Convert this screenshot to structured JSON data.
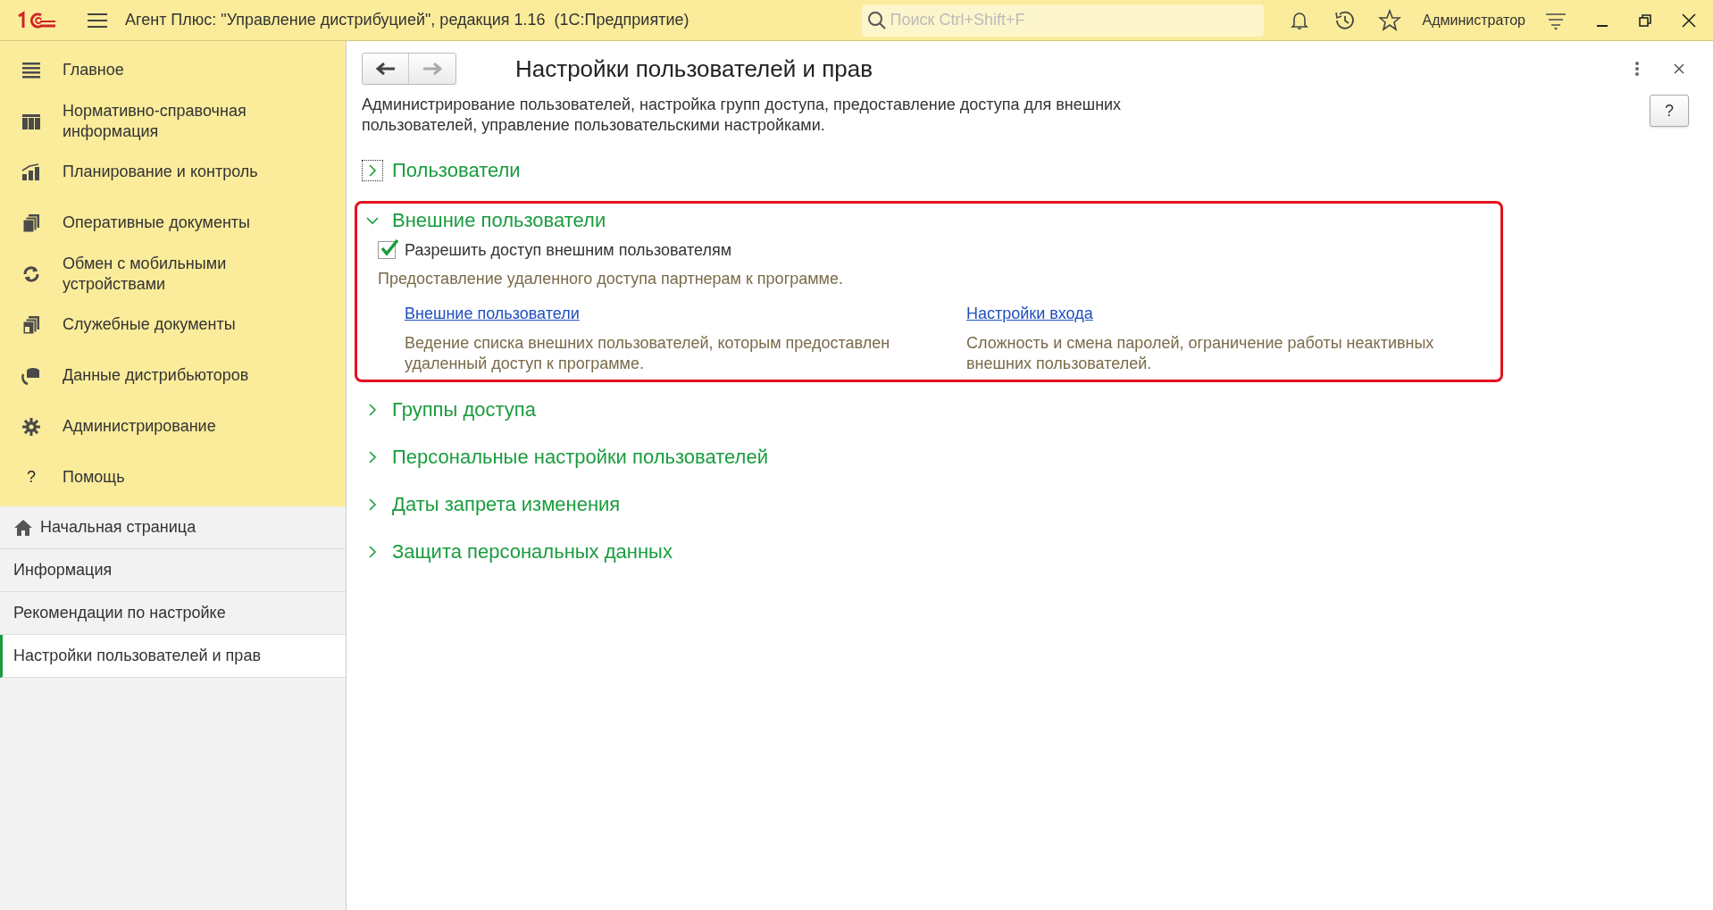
{
  "window": {
    "title": "Агент Плюс: \"Управление дистрибуцией\", редакция 1.16  (1С:Предприятие)",
    "search_placeholder": "Поиск Ctrl+Shift+F",
    "user": "Администратор"
  },
  "sections_menu": [
    {
      "label": "Главное"
    },
    {
      "label": "Нормативно-справочная информация"
    },
    {
      "label": "Планирование и контроль"
    },
    {
      "label": "Оперативные документы"
    },
    {
      "label": "Обмен с мобильными устройствами"
    },
    {
      "label": "Служебные документы"
    },
    {
      "label": "Данные дистрибьюторов"
    },
    {
      "label": "Администрирование"
    },
    {
      "label": "Помощь",
      "glyph": "?"
    }
  ],
  "open_pages": [
    {
      "label": "Начальная страница",
      "kind": "home",
      "selected": false
    },
    {
      "label": "Информация",
      "kind": "page",
      "selected": false
    },
    {
      "label": "Рекомендации по настройке",
      "kind": "page",
      "selected": false
    },
    {
      "label": "Настройки пользователей и прав",
      "kind": "page",
      "selected": true
    }
  ],
  "form": {
    "title": "Настройки пользователей и прав",
    "help_button": "?",
    "description": "Администрирование пользователей, настройка групп доступа, предоставление доступа для внешних пользователей, управление пользовательскими настройками.",
    "groups": [
      {
        "title": "Пользователи",
        "expanded": false,
        "focused": true,
        "highlighted": false
      },
      {
        "title": "Внешние пользователи",
        "expanded": true,
        "focused": false,
        "highlighted": true,
        "checkbox": {
          "label": "Разрешить доступ внешним пользователям",
          "checked": true
        },
        "note": "Предоставление удаленного доступа партнерам к программе.",
        "links": [
          {
            "label": "Внешние пользователи",
            "description": "Ведение списка внешних пользователей, которым предоставлен удаленный доступ к программе."
          },
          {
            "label": "Настройки входа",
            "description": "Сложность и смена паролей, ограничение работы неактивных внешних пользователей."
          }
        ]
      },
      {
        "title": "Группы доступа",
        "expanded": false,
        "focused": false,
        "highlighted": false
      },
      {
        "title": "Персональные настройки пользователей",
        "expanded": false,
        "focused": false,
        "highlighted": false
      },
      {
        "title": "Даты запрета изменения",
        "expanded": false,
        "focused": false,
        "highlighted": false
      },
      {
        "title": "Защита персональных данных",
        "expanded": false,
        "focused": false,
        "highlighted": false
      }
    ]
  }
}
